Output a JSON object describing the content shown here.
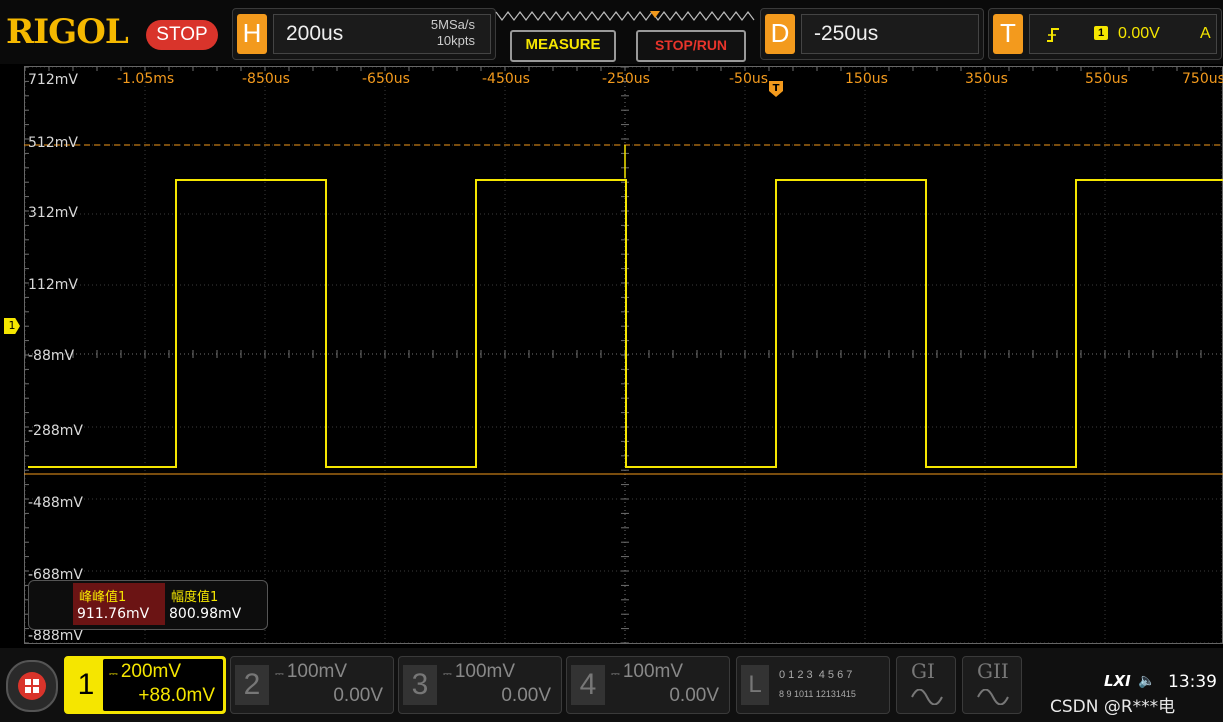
{
  "brand": "RIGOL",
  "run_state": "STOP",
  "horizontal": {
    "letter": "H",
    "timebase": "200us",
    "sample_rate": "5MSa/s",
    "memory_depth": "10kpts"
  },
  "buttons": {
    "measure": "MEASURE",
    "stop_run": "STOP/RUN"
  },
  "delay": {
    "letter": "D",
    "value": "-250us"
  },
  "trigger": {
    "letter": "T",
    "channel": "1",
    "level": "0.00V",
    "mode": "A"
  },
  "y_axis": [
    "712mV",
    "512mV",
    "312mV",
    "112mV",
    "-88mV",
    "-288mV",
    "-488mV",
    "-688mV",
    "-888mV"
  ],
  "x_axis": [
    "-1.05ms",
    "-850us",
    "-650us",
    "-450us",
    "-250us",
    "-50us",
    "150us",
    "350us",
    "550us",
    "750us"
  ],
  "channel1_marker": "1",
  "measurements": [
    {
      "name": "峰峰值1",
      "value": "911.76mV"
    },
    {
      "name": "幅度值1",
      "value": "800.98mV"
    }
  ],
  "channels": [
    {
      "num": "1",
      "scale": "200mV",
      "offset": "+88.0mV",
      "active": true
    },
    {
      "num": "2",
      "scale": "100mV",
      "offset": "0.00V",
      "active": false
    },
    {
      "num": "3",
      "scale": "100mV",
      "offset": "0.00V",
      "active": false
    },
    {
      "num": "4",
      "scale": "100mV",
      "offset": "0.00V",
      "active": false
    }
  ],
  "logic": {
    "letter": "L",
    "row1": "0 1 2 3  4 5 6 7",
    "row2": "8 9 1011 12131415"
  },
  "generators": [
    "GI",
    "GII"
  ],
  "status": {
    "lxi": "LXI",
    "time": "13:39",
    "watermark": "CSDN @R***电"
  },
  "colors": {
    "ch1": "#f5e600",
    "accent": "#f39a1d",
    "stop": "#d9342b"
  }
}
